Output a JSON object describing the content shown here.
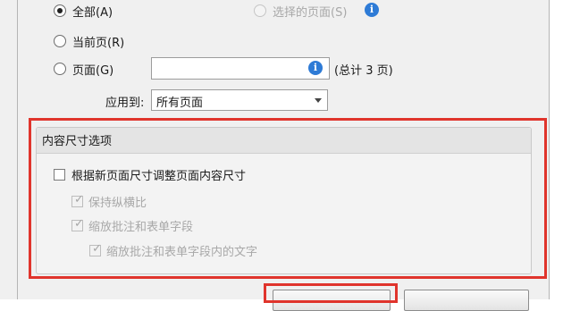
{
  "pages": {
    "all_label": "全部(A)",
    "selected_label": "选择的页面(S)",
    "current_label": "当前页(R)",
    "pages_label": "页面(G)",
    "pages_value": "",
    "total_label": "(总计 3 页)"
  },
  "apply": {
    "label": "应用到:",
    "selected": "所有页面"
  },
  "content_size": {
    "title": "内容尺寸选项",
    "resize_content": "根据新页面尺寸调整页面内容尺寸",
    "keep_aspect": "保持纵横比",
    "scale_annotations": "缩放批注和表单字段",
    "scale_annotation_text": "缩放批注和表单字段内的文字"
  },
  "colors": {
    "highlight": "#e0342c",
    "info": "#2e7bd6"
  },
  "icons": {
    "info": "info-icon",
    "dropdown": "chevron-down-icon",
    "check": "check-icon"
  }
}
